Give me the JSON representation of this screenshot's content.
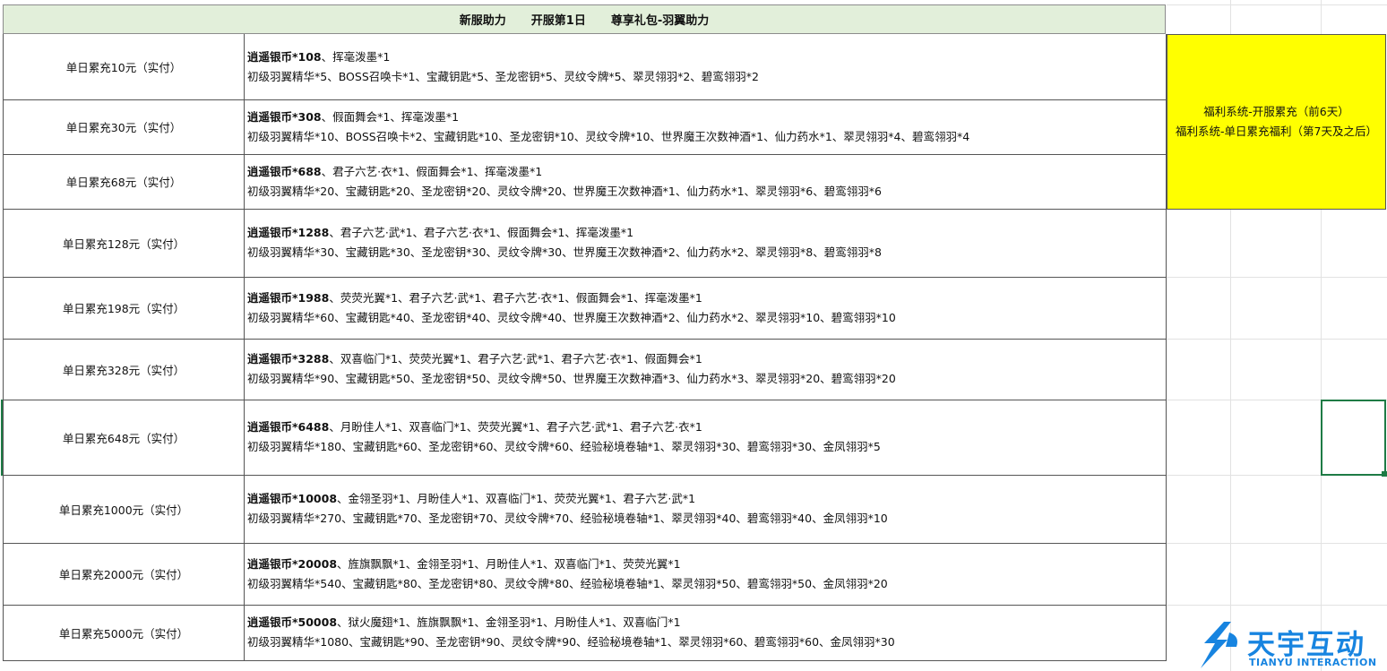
{
  "header": {
    "part1": "新服助力",
    "part2": "开服第1日",
    "part3": "尊享礼包-羽翼助力"
  },
  "rows": [
    {
      "label": "单日累充10元（实付）",
      "bold": "逍遥银币*108",
      "line1": "、挥毫泼墨*1",
      "line2": "初级羽翼精华*5、BOSS召唤卡*1、宝藏钥匙*5、圣龙密钥*5、灵纹令牌*5、翠灵翎羽*2、碧鸾翎羽*2"
    },
    {
      "label": "单日累充30元（实付）",
      "bold": "逍遥银币*308",
      "line1": "、假面舞会*1、挥毫泼墨*1",
      "line2": "初级羽翼精华*10、BOSS召唤卡*2、宝藏钥匙*10、圣龙密钥*10、灵纹令牌*10、世界魔王次数神酒*1、仙力药水*1、翠灵翎羽*4、碧鸾翎羽*4"
    },
    {
      "label": "单日累充68元（实付）",
      "bold": "逍遥银币*688",
      "line1": "、君子六艺·衣*1、假面舞会*1、挥毫泼墨*1",
      "line2": "初级羽翼精华*20、宝藏钥匙*20、圣龙密钥*20、灵纹令牌*20、世界魔王次数神酒*1、仙力药水*1、翠灵翎羽*6、碧鸾翎羽*6"
    },
    {
      "label": "单日累充128元（实付）",
      "bold": "逍遥银币*1288",
      "line1": "、君子六艺·武*1、君子六艺·衣*1、假面舞会*1、挥毫泼墨*1",
      "line2": "初级羽翼精华*30、宝藏钥匙*30、圣龙密钥*30、灵纹令牌*30、世界魔王次数神酒*2、仙力药水*2、翠灵翎羽*8、碧鸾翎羽*8"
    },
    {
      "label": "单日累充198元（实付）",
      "bold": "逍遥银币*1988",
      "line1": "、荧荧光翼*1、君子六艺·武*1、君子六艺·衣*1、假面舞会*1、挥毫泼墨*1",
      "line2": "初级羽翼精华*60、宝藏钥匙*40、圣龙密钥*40、灵纹令牌*40、世界魔王次数神酒*2、仙力药水*2、翠灵翎羽*10、碧鸾翎羽*10"
    },
    {
      "label": "单日累充328元（实付）",
      "bold": "逍遥银币*3288",
      "line1": "、双喜临门*1、荧荧光翼*1、君子六艺·武*1、君子六艺·衣*1、假面舞会*1",
      "line2": "初级羽翼精华*90、宝藏钥匙*50、圣龙密钥*50、灵纹令牌*50、世界魔王次数神酒*3、仙力药水*3、翠灵翎羽*20、碧鸾翎羽*20"
    },
    {
      "label": "单日累充648元（实付）",
      "bold": "逍遥银币*6488",
      "line1": "、月盼佳人*1、双喜临门*1、荧荧光翼*1、君子六艺·武*1、君子六艺·衣*1",
      "line2": "初级羽翼精华*180、宝藏钥匙*60、圣龙密钥*60、灵纹令牌*60、经验秘境卷轴*1、翠灵翎羽*30、碧鸾翎羽*30、金凤翎羽*5"
    },
    {
      "label": "单日累充1000元（实付）",
      "bold": "逍遥银币*10008",
      "line1": "、金翎圣羽*1、月盼佳人*1、双喜临门*1、荧荧光翼*1、君子六艺·武*1",
      "line2": "初级羽翼精华*270、宝藏钥匙*70、圣龙密钥*70、灵纹令牌*70、经验秘境卷轴*1、翠灵翎羽*40、碧鸾翎羽*40、金凤翎羽*10"
    },
    {
      "label": "单日累充2000元（实付）",
      "bold": "逍遥银币*20008",
      "line1": "、旌旗飘飘*1、金翎圣羽*1、月盼佳人*1、双喜临门*1、荧荧光翼*1",
      "line2": "初级羽翼精华*540、宝藏钥匙*80、圣龙密钥*80、灵纹令牌*80、经验秘境卷轴*1、翠灵翎羽*50、碧鸾翎羽*50、金凤翎羽*20"
    },
    {
      "label": "单日累充5000元（实付）",
      "bold": "逍遥银币*50008",
      "line1": "、狱火魔翅*1、旌旗飘飘*1、金翎圣羽*1、月盼佳人*1、双喜临门*1",
      "line2": "初级羽翼精华*1080、宝藏钥匙*90、圣龙密钥*90、灵纹令牌*90、经验秘境卷轴*1、翠灵翎羽*60、碧鸾翎羽*60、金凤翎羽*30"
    }
  ],
  "note": {
    "line1": "福利系统-开服累充（前6天）",
    "line2": "福利系统-单日累充福利（第7天及之后）"
  },
  "logo": {
    "text": "天宇互动",
    "sub": "TIANYU INTERACTION"
  },
  "colors": {
    "header_bg": "#e2efda",
    "note_bg": "#ffff00",
    "selection": "#1e7b45",
    "logo": "#1784e0"
  }
}
